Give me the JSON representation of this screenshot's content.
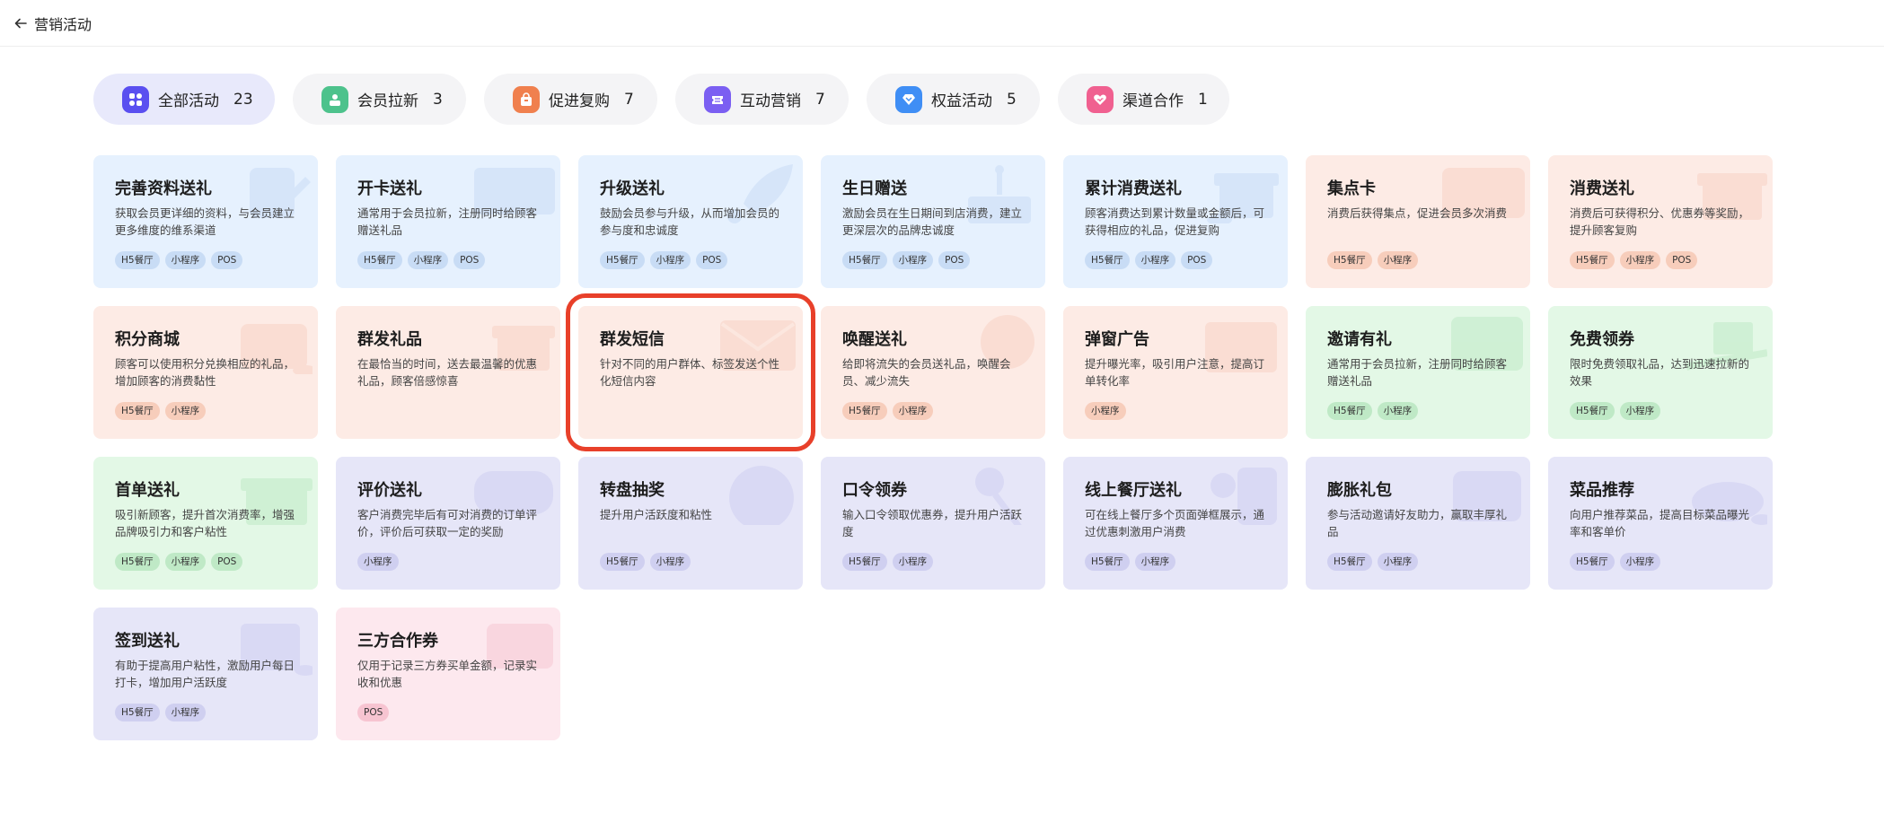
{
  "header": {
    "back_label": "营销活动"
  },
  "tabs": [
    {
      "label": "全部活动",
      "count": "23",
      "icon": "grid-apps-icon",
      "color": "#5a4ff0"
    },
    {
      "label": "会员拉新",
      "count": "3",
      "icon": "member-card-icon",
      "color": "#4dc28c"
    },
    {
      "label": "促进复购",
      "count": "7",
      "icon": "shopping-bag-icon",
      "color": "#f0804e"
    },
    {
      "label": "互动营销",
      "count": "7",
      "icon": "ticket-icon",
      "color": "#7b5ff2"
    },
    {
      "label": "权益活动",
      "count": "5",
      "icon": "diamond-icon",
      "color": "#3f8ef5"
    },
    {
      "label": "渠道合作",
      "count": "1",
      "icon": "heart-handshake-icon",
      "color": "#f06090"
    }
  ],
  "cards": [
    {
      "title": "完善资料送礼",
      "desc": "获取会员更详细的资料，与会员建立更多维度的维系渠道",
      "tags": [
        "H5餐厅",
        "小程序",
        "POS"
      ],
      "icon": "edit-profile-icon"
    },
    {
      "title": "开卡送礼",
      "desc": "通常用于会员拉新，注册同时给顾客赠送礼品",
      "tags": [
        "H5餐厅",
        "小程序",
        "POS"
      ],
      "icon": "card-icon"
    },
    {
      "title": "升级送礼",
      "desc": "鼓励会员参与升级，从而增加会员的参与度和忠诚度",
      "tags": [
        "H5餐厅",
        "小程序",
        "POS"
      ],
      "icon": "rocket-icon"
    },
    {
      "title": "生日赠送",
      "desc": "激励会员在生日期间到店消费，建立更深层次的品牌忠诚度",
      "tags": [
        "H5餐厅",
        "小程序",
        "POS"
      ],
      "icon": "cake-icon"
    },
    {
      "title": "累计消费送礼",
      "desc": "顾客消费达到累计数量或金额后，可获得相应的礼品，促进复购",
      "tags": [
        "H5餐厅",
        "小程序",
        "POS"
      ],
      "icon": "gift-coins-icon"
    },
    {
      "title": "集点卡",
      "desc": "消费后获得集点，促进会员多次消费",
      "tags": [
        "H5餐厅",
        "小程序"
      ],
      "icon": "stamp-card-icon"
    },
    {
      "title": "消费送礼",
      "desc": "消费后可获得积分、优惠券等奖励，提升顾客复购",
      "tags": [
        "H5餐厅",
        "小程序",
        "POS"
      ],
      "icon": "gift-icon"
    },
    {
      "title": "积分商城",
      "desc": "顾客可以使用积分兑换相应的礼品，增加顾客的消费黏性",
      "tags": [
        "H5餐厅",
        "小程序"
      ],
      "icon": "store-coins-icon"
    },
    {
      "title": "群发礼品",
      "desc": "在最恰当的时间，送去最温馨的优惠礼品，顾客倍感惊喜",
      "tags": [],
      "icon": "gift-box-icon"
    },
    {
      "title": "群发短信",
      "desc": "针对不同的用户群体、标签发送个性化短信内容",
      "tags": [],
      "icon": "envelope-icon"
    },
    {
      "title": "唤醒送礼",
      "desc": "给即将流失的会员送礼品，唤醒会员、减少流失",
      "tags": [
        "H5餐厅",
        "小程序"
      ],
      "icon": "heart-bubble-icon"
    },
    {
      "title": "弹窗广告",
      "desc": "提升曝光率，吸引用户注意，提高订单转化率",
      "tags": [
        "小程序"
      ],
      "icon": "popup-ad-icon"
    },
    {
      "title": "邀请有礼",
      "desc": "通常用于会员拉新，注册同时给顾客赠送礼品",
      "tags": [
        "H5餐厅",
        "小程序"
      ],
      "icon": "invite-heart-icon"
    },
    {
      "title": "免费领券",
      "desc": "限时免费领取礼品，达到迅速拉新的效果",
      "tags": [
        "H5餐厅",
        "小程序"
      ],
      "icon": "gift-hand-icon"
    },
    {
      "title": "首单送礼",
      "desc": "吸引新顾客，提升首次消费率，增强品牌吸引力和客户粘性",
      "tags": [
        "H5餐厅",
        "小程序",
        "POS"
      ],
      "icon": "first-order-gift-icon"
    },
    {
      "title": "评价送礼",
      "desc": "客户消费完毕后有可对消费的订单评价，评价后可获取一定的奖励",
      "tags": [
        "小程序"
      ],
      "icon": "comment-bubble-icon"
    },
    {
      "title": "转盘抽奖",
      "desc": "提升用户活跃度和粘性",
      "tags": [
        "H5餐厅",
        "小程序"
      ],
      "icon": "wheel-icon"
    },
    {
      "title": "口令领券",
      "desc": "输入口令领取优惠券，提升用户活跃度",
      "tags": [
        "H5餐厅",
        "小程序"
      ],
      "icon": "key-icon"
    },
    {
      "title": "线上餐厅送礼",
      "desc": "可在线上餐厅多个页面弹框展示，通过优惠刺激用户消费",
      "tags": [
        "H5餐厅",
        "小程序"
      ],
      "icon": "phone-location-icon"
    },
    {
      "title": "膨胀礼包",
      "desc": "参与活动邀请好友助力，赢取丰厚礼品",
      "tags": [
        "H5餐厅",
        "小程序"
      ],
      "icon": "bag-icon"
    },
    {
      "title": "菜品推荐",
      "desc": "向用户推荐菜品，提高目标菜品曝光率和客单价",
      "tags": [
        "H5餐厅",
        "小程序"
      ],
      "icon": "dish-coins-icon"
    },
    {
      "title": "签到送礼",
      "desc": "有助于提高用户粘性，激励用户每日打卡，增加用户活跃度",
      "tags": [
        "H5餐厅",
        "小程序"
      ],
      "icon": "calendar-coins-icon"
    },
    {
      "title": "三方合作券",
      "desc": "仅用于记录三方券买单金额，记录实收和优惠",
      "tags": [
        "POS"
      ],
      "icon": "wallet-icon"
    }
  ]
}
